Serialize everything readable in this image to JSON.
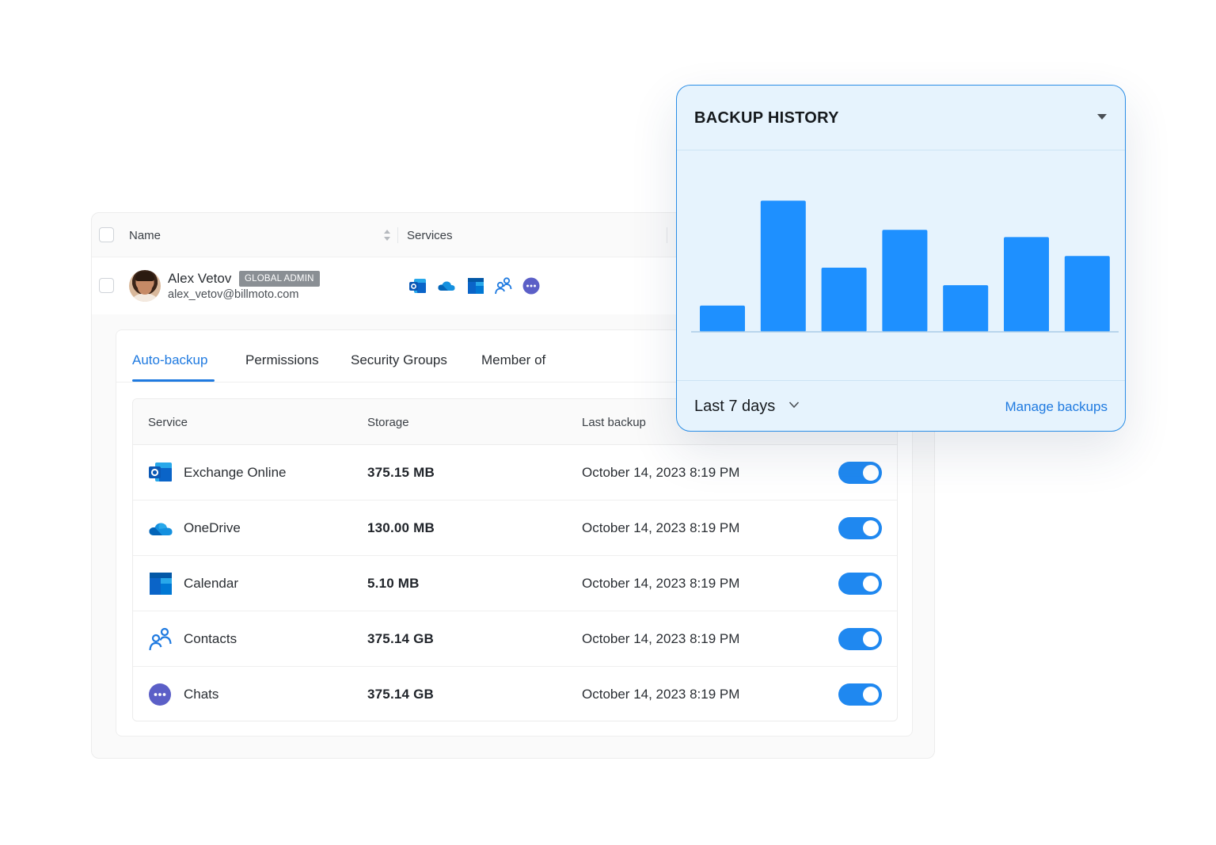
{
  "list": {
    "header": {
      "name_label": "Name",
      "services_label": "Services"
    },
    "user": {
      "name": "Alex Vetov",
      "role_badge": "GLOBAL ADMIN",
      "email": "alex_vetov@billmoto.com",
      "services": [
        "exchange-icon",
        "onedrive-icon",
        "calendar-icon",
        "contacts-icon",
        "chats-icon"
      ]
    }
  },
  "tabs": [
    {
      "label": "Auto-backup",
      "active": true
    },
    {
      "label": "Permissions",
      "active": false
    },
    {
      "label": "Security Groups",
      "active": false
    },
    {
      "label": "Member of",
      "active": false
    }
  ],
  "table": {
    "columns": {
      "service": "Service",
      "storage": "Storage",
      "last_backup": "Last backup"
    },
    "rows": [
      {
        "icon": "exchange-icon",
        "service": "Exchange Online",
        "storage": "375.15 MB",
        "last_backup": "October 14, 2023 8:19 PM",
        "enabled": true
      },
      {
        "icon": "onedrive-icon",
        "service": "OneDrive",
        "storage": "130.00 MB",
        "last_backup": "October 14, 2023 8:19 PM",
        "enabled": true
      },
      {
        "icon": "calendar-icon",
        "service": "Calendar",
        "storage": "5.10 MB",
        "last_backup": "October 14, 2023 8:19 PM",
        "enabled": true
      },
      {
        "icon": "contacts-icon",
        "service": "Contacts",
        "storage": "375.14 GB",
        "last_backup": "October 14, 2023 8:19 PM",
        "enabled": true
      },
      {
        "icon": "chats-icon",
        "service": "Chats",
        "storage": "375.14 GB",
        "last_backup": "October 14, 2023 8:19 PM",
        "enabled": true
      }
    ]
  },
  "history": {
    "title": "BACKUP HISTORY",
    "range_label": "Last 7 days",
    "manage_label": "Manage backups"
  },
  "colors": {
    "accent": "#1f7ae0",
    "bar": "#1e90ff",
    "toggle_on": "#1f88f0",
    "popup_bg": "#e6f3fd"
  },
  "chart_data": {
    "type": "bar",
    "categories": [
      "",
      "",
      "",
      "",
      "",
      "",
      ""
    ],
    "values": [
      18,
      90,
      44,
      70,
      32,
      65,
      52
    ],
    "ylim": [
      0,
      100
    ],
    "grid": false
  }
}
